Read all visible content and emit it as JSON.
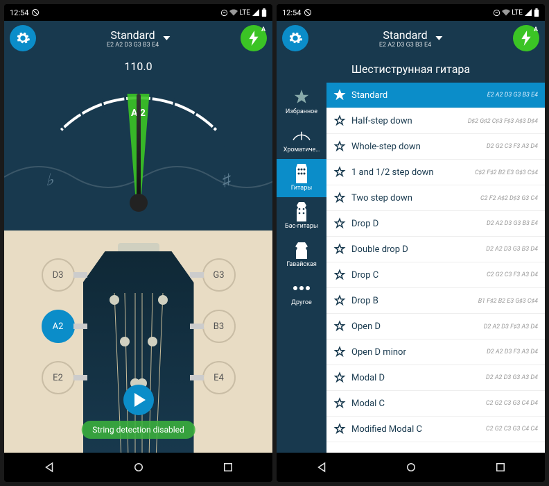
{
  "statusbar": {
    "time": "12:54",
    "net": "LTE"
  },
  "appbar": {
    "tuning_name": "Standard",
    "tuning_notes": "E2 A2 D3 G3 B3 E4",
    "bolt_badge": "A"
  },
  "tuner": {
    "freq": "110.0",
    "note": "A 2",
    "flat": "♭",
    "sharp": "♯",
    "pegs": [
      {
        "label": "D3"
      },
      {
        "label": "G3"
      },
      {
        "label": "A2"
      },
      {
        "label": "B3"
      },
      {
        "label": "E2"
      },
      {
        "label": "E4"
      }
    ],
    "active_peg_index": 2,
    "toast": "String detection disabled"
  },
  "right": {
    "header": "Шестиструнная гитара",
    "sidebar": [
      {
        "label": "Избранное"
      },
      {
        "label": "Хроматиче…"
      },
      {
        "label": "Гитары"
      },
      {
        "label": "Бас-гитары"
      },
      {
        "label": "Гавайская"
      },
      {
        "label": "Другое"
      }
    ],
    "sidebar_active": 2,
    "tunings": [
      {
        "name": "Standard",
        "notes": "E2 A2 D3 G3 B3 E4",
        "selected": true,
        "starred": true
      },
      {
        "name": "Half-step down",
        "notes": "D♯2 G♯2 C♯3 F♯3 A♯3 D♯4"
      },
      {
        "name": "Whole-step down",
        "notes": "D2 G2 C3 F3 A3 D4"
      },
      {
        "name": "1 and 1/2 step down",
        "notes": "C♯2 F♯2 B2 E3 G♯3 C♯4"
      },
      {
        "name": "Two step down",
        "notes": "C2 F2 A♯2 D♯3 G3 C4"
      },
      {
        "name": "Drop D",
        "notes": "D2 A2 D3 G3 B3 E4"
      },
      {
        "name": "Double drop D",
        "notes": "D2 A2 D3 G3 B3 D4"
      },
      {
        "name": "Drop C",
        "notes": "C2 G2 C3 F3 A3 D4"
      },
      {
        "name": "Drop B",
        "notes": "B1 F♯2 B2 E3 G♯3 C♯4"
      },
      {
        "name": "Open D",
        "notes": "D2 A2 D3 F♯3 A3 D4"
      },
      {
        "name": "Open D minor",
        "notes": "D2 A2 D3 F3 A3 D4"
      },
      {
        "name": "Modal D",
        "notes": "D2 A2 D3 G3 A3 D4"
      },
      {
        "name": "Modal C",
        "notes": "C2 G2 C3 G3 C4 D4"
      },
      {
        "name": "Modified Modal C",
        "notes": "C2 G2 C3 G3 C4 C4"
      }
    ]
  }
}
